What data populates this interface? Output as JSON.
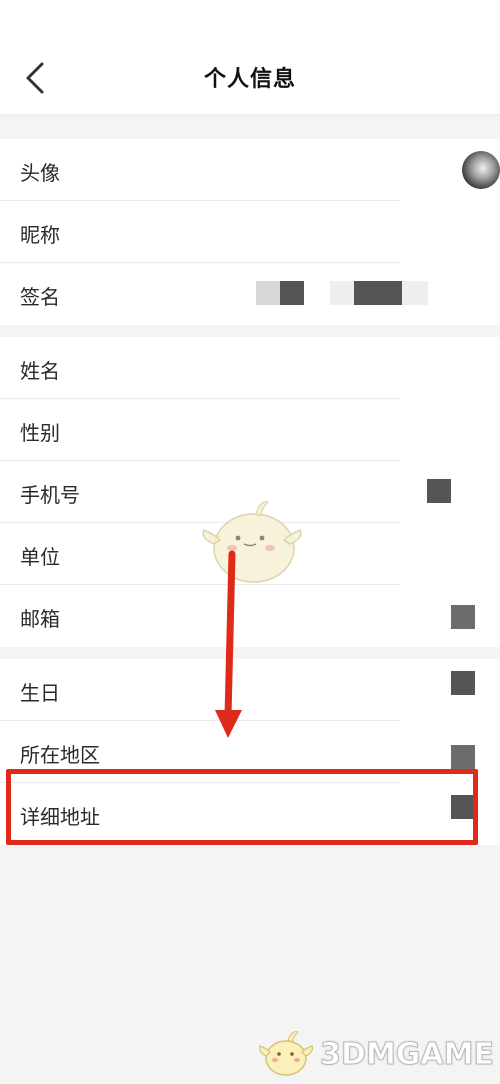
{
  "header": {
    "title": "个人信息",
    "back_icon": "chevron-left-icon"
  },
  "groups": [
    {
      "rows": [
        {
          "label": "头像"
        },
        {
          "label": "昵称"
        },
        {
          "label": "签名"
        }
      ]
    },
    {
      "rows": [
        {
          "label": "姓名"
        },
        {
          "label": "性别"
        },
        {
          "label": "手机号"
        },
        {
          "label": "单位"
        },
        {
          "label": "邮箱"
        }
      ]
    },
    {
      "rows": [
        {
          "label": "生日"
        },
        {
          "label": "所在地区"
        },
        {
          "label": "详细地址"
        }
      ]
    }
  ],
  "annotations": {
    "highlight_color": "#e02a19",
    "arrow_color": "#e02a19",
    "highlighted_row": "详细地址"
  },
  "watermark": {
    "text": "3DMGAME",
    "mascot_icon": "mascot-icon"
  }
}
